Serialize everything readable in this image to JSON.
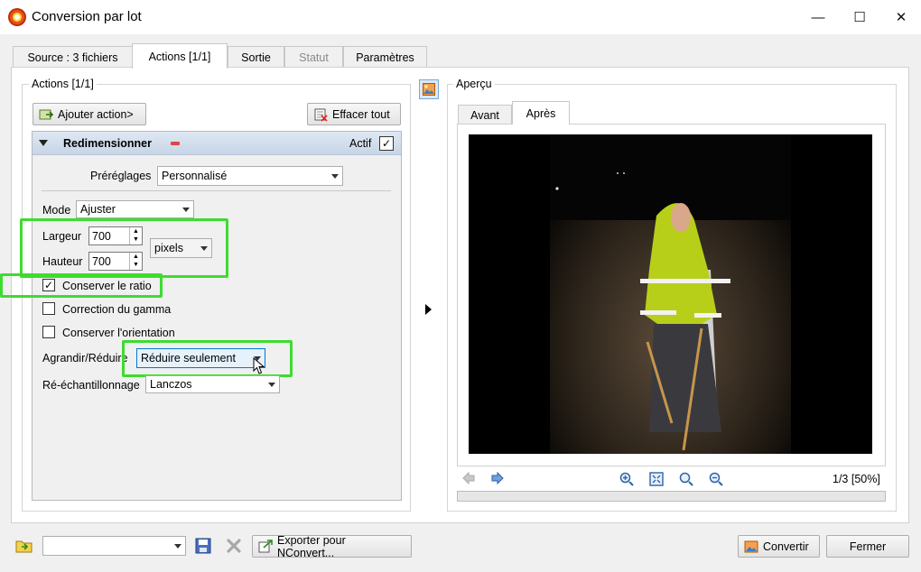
{
  "window": {
    "title": "Conversion par lot",
    "icon": "xnview-icon",
    "minimize_glyph": "—",
    "maximize_glyph": "☐",
    "close_glyph": "✕"
  },
  "tabs": [
    {
      "label": "Source : 3 fichiers",
      "state": "normal"
    },
    {
      "label": "Actions [1/1]",
      "state": "active"
    },
    {
      "label": "Sortie",
      "state": "normal"
    },
    {
      "label": "Statut",
      "state": "disabled"
    },
    {
      "label": "Paramètres",
      "state": "normal"
    }
  ],
  "actions": {
    "group_title": "Actions [1/1]",
    "add_action_label": "Ajouter action>",
    "clear_all_label": "Effacer tout",
    "resize_action": {
      "title": "Redimensionner",
      "active_label": "Actif",
      "active_checked": true,
      "presets_label": "Préréglages",
      "presets_value": "Personnalisé",
      "mode_label": "Mode",
      "mode_value": "Ajuster",
      "width_label": "Largeur",
      "width_value": "700",
      "height_label": "Hauteur",
      "height_value": "700",
      "unit_value": "pixels",
      "keep_ratio_label": "Conserver le ratio",
      "keep_ratio_checked": true,
      "gamma_label": "Correction du gamma",
      "gamma_checked": false,
      "orientation_label": "Conserver l'orientation",
      "orientation_checked": false,
      "enlarge_reduce_label": "Agrandir/Réduire",
      "enlarge_reduce_value": "Réduire seulement",
      "resample_label": "Ré-échantillonnage",
      "resample_value": "Lanczos"
    }
  },
  "preview": {
    "group_title": "Aperçu",
    "tab_before": "Avant",
    "tab_after": "Après",
    "page_info": "1/3 [50%]"
  },
  "bottom": {
    "export_label": "Exporter pour NConvert...",
    "convert_label": "Convertir",
    "close_label": "Fermer"
  },
  "colors": {
    "highlight": "#3ddc2f",
    "header_bar": "#c7d5e6"
  }
}
